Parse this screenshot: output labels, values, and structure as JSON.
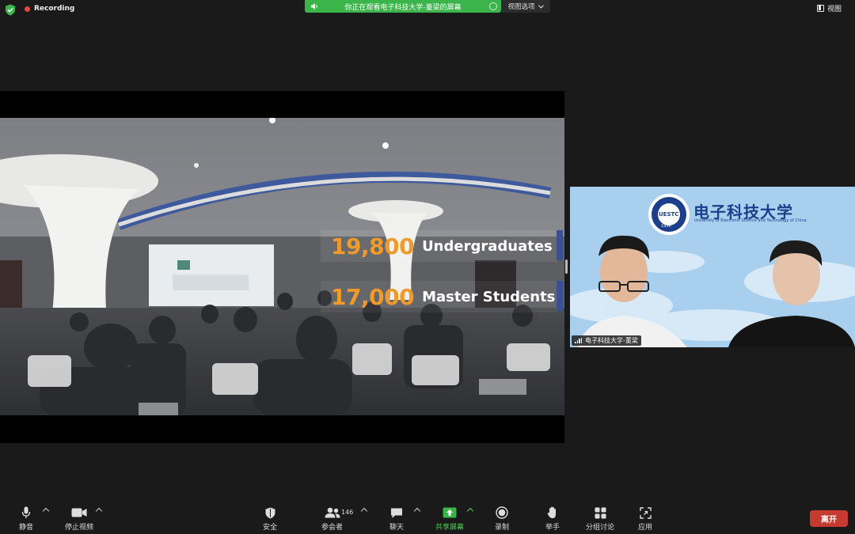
{
  "top_bar": {
    "recording_label": "Recording",
    "share_banner": "你正在观看电子科技大学-董梁的屏幕",
    "view_options_label": "视图选项",
    "view_label": "视图"
  },
  "shared_screen": {
    "stats": [
      {
        "number": "19,800",
        "label": "Undergraduates"
      },
      {
        "number": "17,000",
        "label": "Master Students"
      }
    ]
  },
  "video_tile": {
    "participant_name": "电子科技大学-董梁",
    "logo_text_cn": "电子科技大学",
    "logo_text_en": "University of Electronic Science and Technology of China",
    "logo_year": "1956",
    "logo_abbr": "UESTC"
  },
  "toolbar": {
    "mute": "静音",
    "stop_video": "停止视频",
    "security": "安全",
    "participants": "参会者",
    "participant_count": "146",
    "chat": "聊天",
    "share_screen": "共享屏幕",
    "record": "录制",
    "raise_hand": "举手",
    "breakout": "分组讨论",
    "apps": "应用",
    "leave": "离开"
  },
  "colors": {
    "accent_green": "#3bb54a",
    "leave_red": "#c73a30",
    "stat_orange": "#f09a2b",
    "record_red": "#e5483f"
  }
}
